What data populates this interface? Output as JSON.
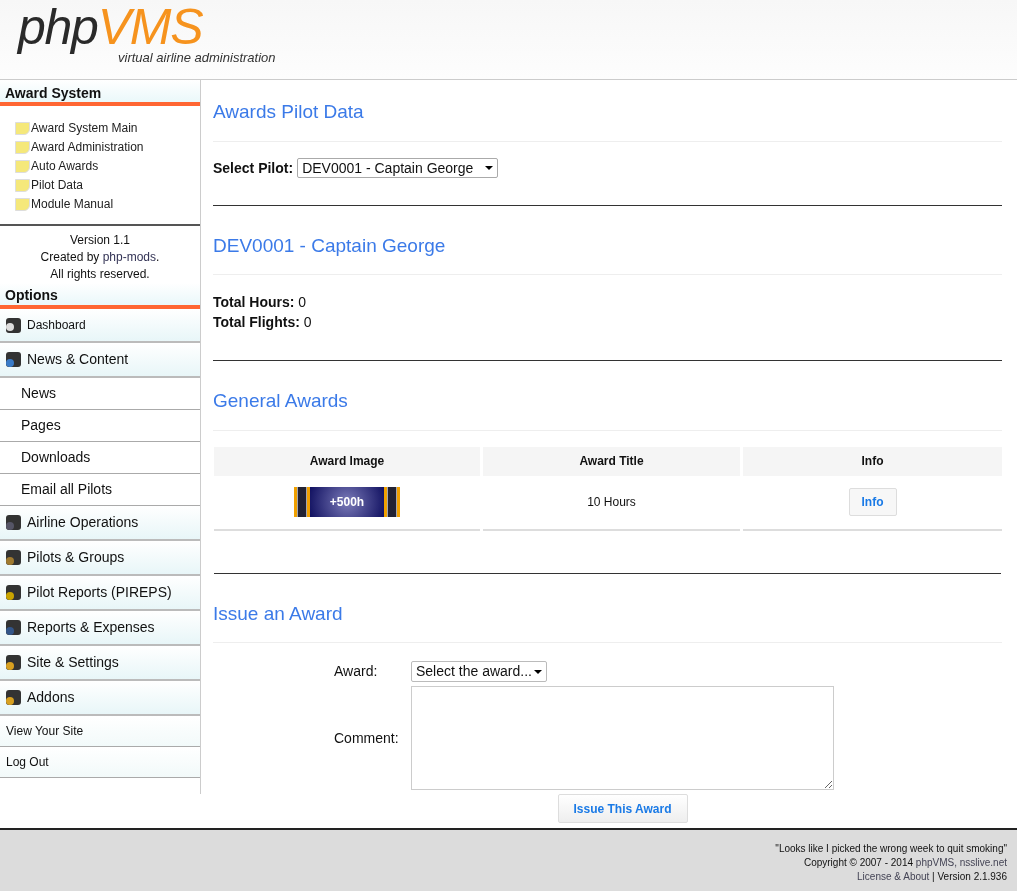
{
  "logo": {
    "part_1": "php",
    "part_2": "VMS",
    "tagline": "virtual airline administration"
  },
  "award_system": {
    "heading": "Award System",
    "links": [
      "Award System Main",
      "Award Administration",
      "Auto Awards",
      "Pilot Data",
      "Module Manual"
    ],
    "version": "Version 1.1",
    "credit_prefix": "Created by ",
    "credit_link": "php-mods",
    "credit_suffix": ".",
    "rights": "All rights reserved."
  },
  "options": {
    "heading": "Options",
    "items": [
      {
        "label": "Dashboard",
        "kind": "small"
      },
      {
        "label": "News & Content",
        "kind": "section"
      },
      {
        "label": "News",
        "kind": "sub"
      },
      {
        "label": "Pages",
        "kind": "sub"
      },
      {
        "label": "Downloads",
        "kind": "sub"
      },
      {
        "label": "Email all Pilots",
        "kind": "sub"
      },
      {
        "label": "Airline Operations",
        "kind": "section"
      },
      {
        "label": "Pilots & Groups",
        "kind": "section"
      },
      {
        "label": "Pilot Reports (PIREPS)",
        "kind": "section"
      },
      {
        "label": "Reports & Expenses",
        "kind": "section"
      },
      {
        "label": "Site & Settings",
        "kind": "section"
      },
      {
        "label": "Addons",
        "kind": "section"
      },
      {
        "label": "View Your Site",
        "kind": "plain"
      },
      {
        "label": "Log Out",
        "kind": "plain"
      }
    ]
  },
  "main": {
    "title": "Awards Pilot Data",
    "select_pilot": {
      "label": "Select Pilot:",
      "value": "DEV0001 - Captain George"
    },
    "pilot_heading": "DEV0001 - Captain George",
    "stats": [
      {
        "label": "Total Hours:",
        "value": "0"
      },
      {
        "label": "Total Flights:",
        "value": "0"
      }
    ],
    "general_awards": {
      "heading": "General Awards",
      "columns": [
        "Award Image",
        "Award Title",
        "Info"
      ],
      "rows": [
        {
          "badge_text": "+500h",
          "title": "10 Hours",
          "button": "Info"
        }
      ]
    },
    "issue": {
      "heading": "Issue an Award",
      "award_label": "Award:",
      "award_placeholder": "Select the award...",
      "comment_label": "Comment:",
      "button": "Issue This Award"
    }
  },
  "footer": {
    "quote": "\"Looks like I picked the wrong week to quit smoking\"",
    "copyright_prefix": "Copyright © 2007 - 2014 ",
    "copyright_link": "phpVMS, nsslive.net",
    "license_link": "License & About",
    "version": " | Version 2.1.936"
  }
}
